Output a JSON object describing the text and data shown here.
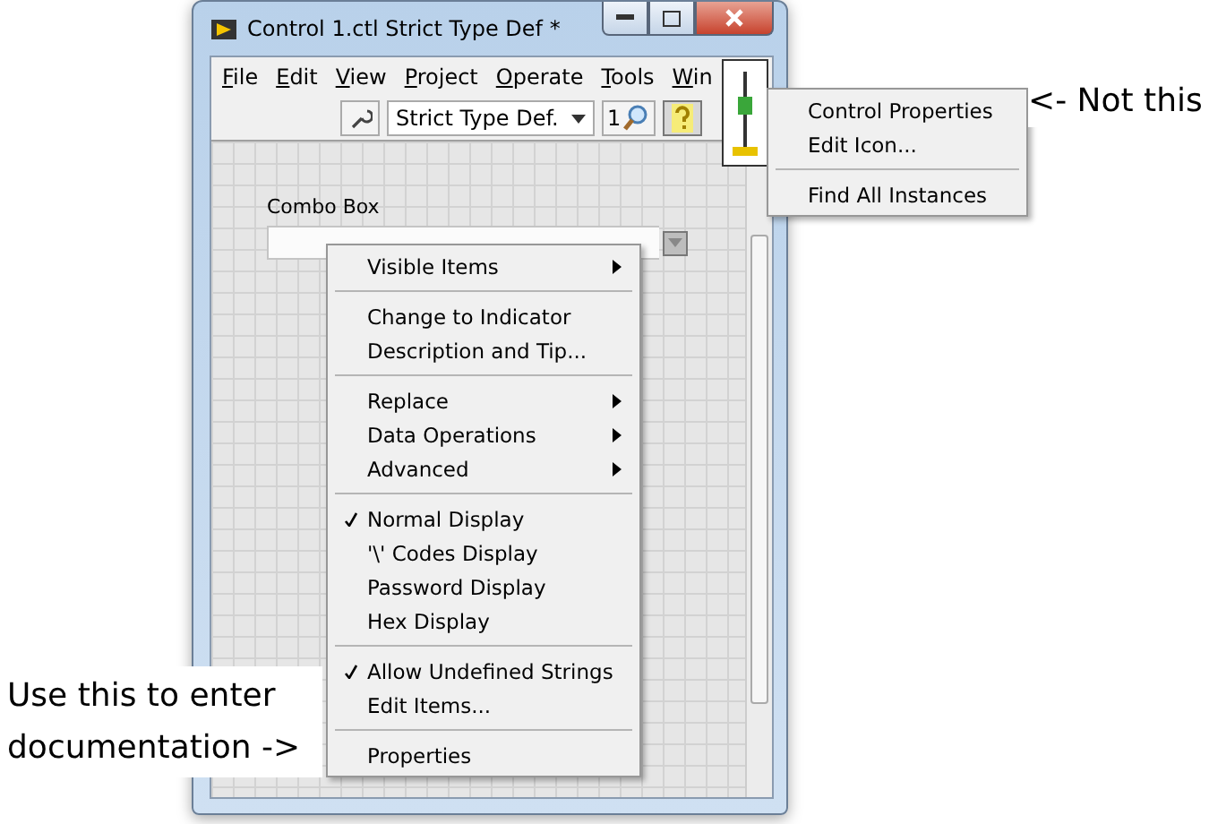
{
  "window": {
    "title": "Control 1.ctl Strict Type Def *"
  },
  "menu_bar": [
    "File",
    "Edit",
    "View",
    "Project",
    "Operate",
    "Tools",
    "Win"
  ],
  "toolbar": {
    "type_dropdown": "Strict Type Def.",
    "zoom_value": "1",
    "help_active": true
  },
  "control": {
    "label": "Combo Box"
  },
  "icon_menu": {
    "groups": [
      [
        "Control Properties",
        "Edit Icon..."
      ],
      [
        "Find All Instances"
      ]
    ]
  },
  "context_menu": {
    "groups": [
      [
        {
          "label": "Visible Items",
          "submenu": true,
          "checked": false
        }
      ],
      [
        {
          "label": "Change to Indicator",
          "submenu": false,
          "checked": false
        },
        {
          "label": "Description and Tip...",
          "submenu": false,
          "checked": false
        }
      ],
      [
        {
          "label": "Replace",
          "submenu": true,
          "checked": false
        },
        {
          "label": "Data Operations",
          "submenu": true,
          "checked": false
        },
        {
          "label": "Advanced",
          "submenu": true,
          "checked": false
        }
      ],
      [
        {
          "label": "Normal Display",
          "submenu": false,
          "checked": true
        },
        {
          "label": "'\\' Codes Display",
          "submenu": false,
          "checked": false
        },
        {
          "label": "Password Display",
          "submenu": false,
          "checked": false
        },
        {
          "label": "Hex Display",
          "submenu": false,
          "checked": false
        }
      ],
      [
        {
          "label": "Allow Undefined Strings",
          "submenu": false,
          "checked": true
        },
        {
          "label": "Edit Items...",
          "submenu": false,
          "checked": false
        }
      ],
      [
        {
          "label": "Properties",
          "submenu": false,
          "checked": false
        }
      ]
    ]
  },
  "annotations": [
    {
      "text": "<- Not this"
    },
    {
      "text": "Use this to enter documentation ->"
    }
  ]
}
